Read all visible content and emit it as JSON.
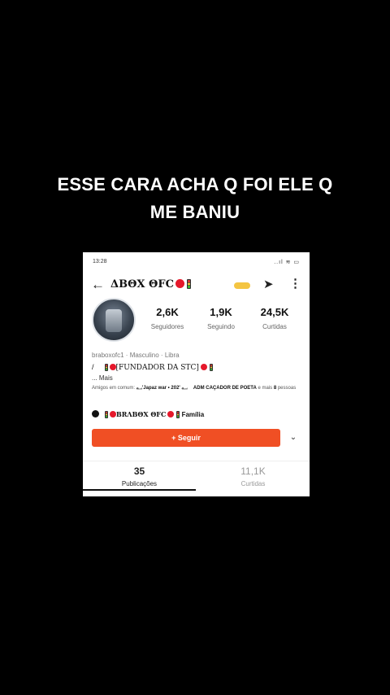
{
  "caption": {
    "line1": "ESSE CARA ACHA Q FOI ELE Q",
    "line2": "ME BANIU"
  },
  "status_bar": {
    "time": "13:28",
    "right": "..ıl ≋ ▭"
  },
  "header": {
    "username": "ΔΒΘΧ ΘFC",
    "back_icon": "arrow-left-icon",
    "share_icon": "share-icon",
    "more_icon": "more-vertical-icon"
  },
  "stats": [
    {
      "value": "2,6K",
      "label": "Seguidores"
    },
    {
      "value": "1,9K",
      "label": "Seguindo"
    },
    {
      "value": "24,5K",
      "label": "Curtidas"
    }
  ],
  "profile": {
    "meta": "braboxofc1 · Masculino · Libra",
    "bio_prefix": "/",
    "bio_title": "[FUNDADOR DA STC]",
    "bio_more": "...  Mais",
    "mutual_prefix": "Amigos em comum:",
    "mutual_names": "𓀿'Japaz war • 202' 𓀿ㅤ ADM CAÇADOR DE POETA",
    "mutual_suffix": "e mais",
    "mutual_count": "8",
    "mutual_end": "pessoas",
    "family_name": "BRΛBΘΧ ΘFC",
    "family_label": "Família"
  },
  "follow_button": {
    "label": "+ Seguir",
    "dropdown_icon": "chevron-down-icon"
  },
  "tabs": [
    {
      "value": "35",
      "label": "Publicações"
    },
    {
      "value": "11,1K",
      "label": "Curtidas"
    }
  ],
  "colors": {
    "accent": "#f04f24",
    "background": "#000000"
  }
}
